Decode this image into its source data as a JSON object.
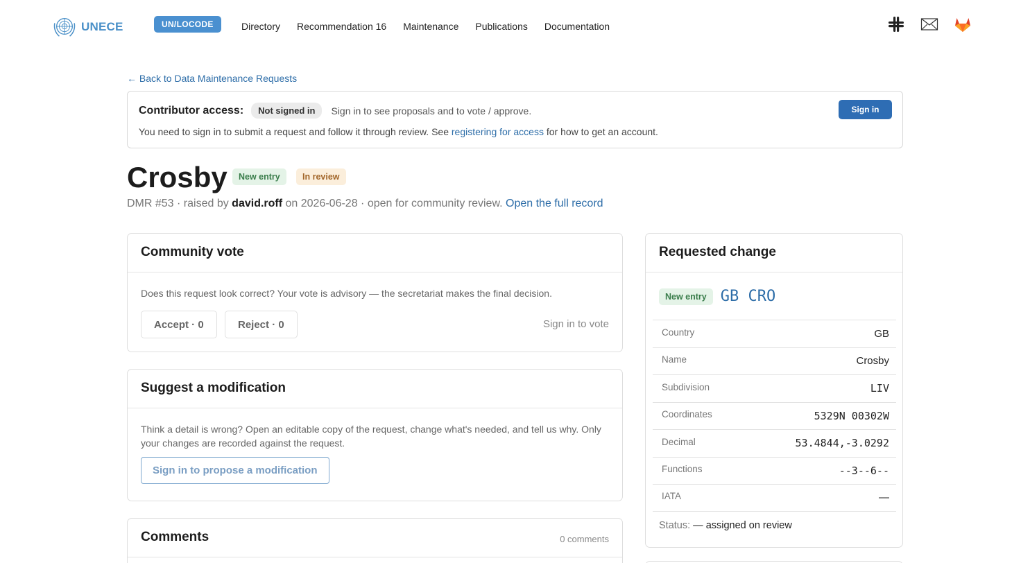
{
  "header": {
    "logo_text": "UNECE",
    "badge": "UN/LOCODE",
    "nav": [
      "Directory",
      "Recommendation 16",
      "Maintenance",
      "Publications",
      "Documentation"
    ],
    "icons": [
      "slack-icon",
      "mail-icon",
      "gitlab-icon"
    ]
  },
  "back_link": "← Back to Data Maintenance Requests",
  "contributor": {
    "label": "Contributor access:",
    "status": "Not signed in",
    "hint": "Sign in to see proposals and to vote / approve.",
    "text_before": "You need to sign in to submit a request and follow it through review. See ",
    "link": "registering for access",
    "text_after": " for how to get an account.",
    "button": "Sign in"
  },
  "request": {
    "title": "Crosby",
    "tags": [
      "New entry",
      "In review"
    ],
    "meta_prefix": "DMR #53 · raised by ",
    "author": "david.roff",
    "meta_suffix": " on 2026-06-28 · open for community review. ",
    "full_record_link": "Open the full record"
  },
  "vote": {
    "heading": "Community vote",
    "description": "Does this request look correct? Your vote is advisory — the secretariat makes the final decision.",
    "accept": "Accept · 0",
    "reject": "Reject · 0",
    "hint": "Sign in to vote"
  },
  "modification": {
    "heading": "Suggest a modification",
    "description": "Think a detail is wrong? Open an editable copy of the request, change what's needed, and tell us why. Only your changes are recorded against the request.",
    "button": "Sign in to propose a modification"
  },
  "comments": {
    "heading": "Comments",
    "count": "0 comments"
  },
  "requested_change": {
    "heading": "Requested change",
    "tag": "New entry",
    "code": "GB CRO",
    "rows": [
      {
        "key": "Country",
        "value": "GB",
        "mono": false
      },
      {
        "key": "Name",
        "value": "Crosby",
        "mono": false
      },
      {
        "key": "Subdivision",
        "value": "LIV",
        "mono": true
      },
      {
        "key": "Coordinates",
        "value": "5329N 00302W",
        "mono": true
      },
      {
        "key": "Decimal",
        "value": "53.4844,-3.0292",
        "mono": true
      },
      {
        "key": "Functions",
        "value": "--3--6--",
        "mono": true
      },
      {
        "key": "IATA",
        "value": "—",
        "mono": false
      }
    ],
    "status_label": "Status:",
    "status_value": " — assigned on review"
  }
}
